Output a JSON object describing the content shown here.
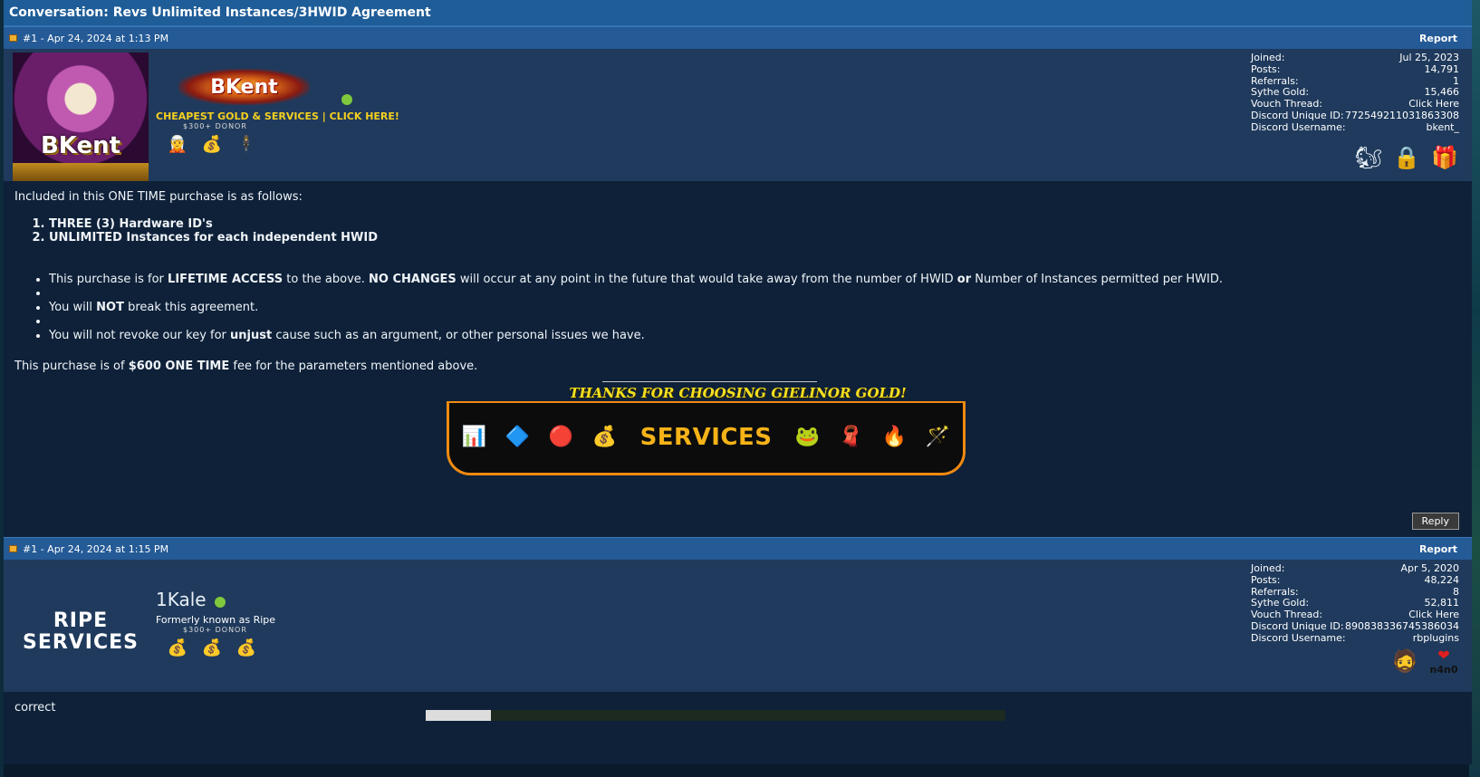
{
  "conversation_title": "Conversation: Revs Unlimited Instances/3HWID Agreement",
  "posts": [
    {
      "header": "#1 - Apr 24, 2024 at 1:13 PM",
      "report": "Report",
      "avatar_text": "BKent",
      "banner_text": "BKent",
      "user_title": "CHEAPEST GOLD & SERVICES | CLICK HERE!",
      "donor": "$300+ DONOR",
      "stats": [
        {
          "label": "Joined:",
          "value": "Jul 25, 2023"
        },
        {
          "label": "Posts:",
          "value": "14,791"
        },
        {
          "label": "Referrals:",
          "value": "1"
        },
        {
          "label": "Sythe Gold:",
          "value": "15,466"
        },
        {
          "label": "Vouch Thread:",
          "value": "Click Here"
        },
        {
          "label": "Discord Unique ID:",
          "value": "772549211031863308"
        },
        {
          "label": "Discord Username:",
          "value": "bkent_"
        }
      ],
      "body": {
        "intro": "Included in this ONE TIME purchase is as follows:",
        "ordered": [
          "THREE (3) Hardware ID's",
          "UNLIMITED Instances for each independent HWID"
        ],
        "b1_a": "This purchase is for ",
        "b1_b": "LIFETIME ACCESS",
        "b1_c": " to the above. ",
        "b1_d": "NO CHANGES",
        "b1_e": " will occur at any point in the future that would take away from the number of HWID ",
        "b1_f": "or",
        "b1_g": " Number of Instances permitted per HWID.",
        "b2_a": "You will ",
        "b2_b": "NOT",
        "b2_c": " break this agreement.",
        "b3_a": "You will not revoke our key for ",
        "b3_b": "unjust",
        "b3_c": " cause such as an argument, or other personal issues we have.",
        "final_a": "This purchase is of ",
        "final_b": "$600 ONE TIME",
        "final_c": " fee for the parameters mentioned above.",
        "thanks": "THANKS FOR CHOOSING GIELINOR GOLD!",
        "services": "SERVICES"
      },
      "reply": "Reply"
    },
    {
      "header": "#1 - Apr 24, 2024 at 1:15 PM",
      "report": "Report",
      "avatar_text_1": "RIPE",
      "avatar_text_2": "SERVICES",
      "username": "1Kale",
      "subtitle": "Formerly known as Ripe",
      "donor": "$300+ DONOR",
      "stats": [
        {
          "label": "Joined:",
          "value": "Apr 5, 2020"
        },
        {
          "label": "Posts:",
          "value": "48,224"
        },
        {
          "label": "Referrals:",
          "value": "8"
        },
        {
          "label": "Sythe Gold:",
          "value": "52,811"
        },
        {
          "label": "Vouch Thread:",
          "value": "Click Here"
        },
        {
          "label": "Discord Unique ID:",
          "value": "890838336745386034"
        },
        {
          "label": "Discord Username:",
          "value": "rbplugins"
        }
      ],
      "body": "correct",
      "badge_text": "n4n0"
    }
  ],
  "colors": {
    "header_blue": "#245a96",
    "panel_blue": "#1f3a5c",
    "body_navy": "#0e2139",
    "online_green": "#7fc83c",
    "title_yellow": "#f5d020",
    "services_orange": "#f08a10"
  }
}
